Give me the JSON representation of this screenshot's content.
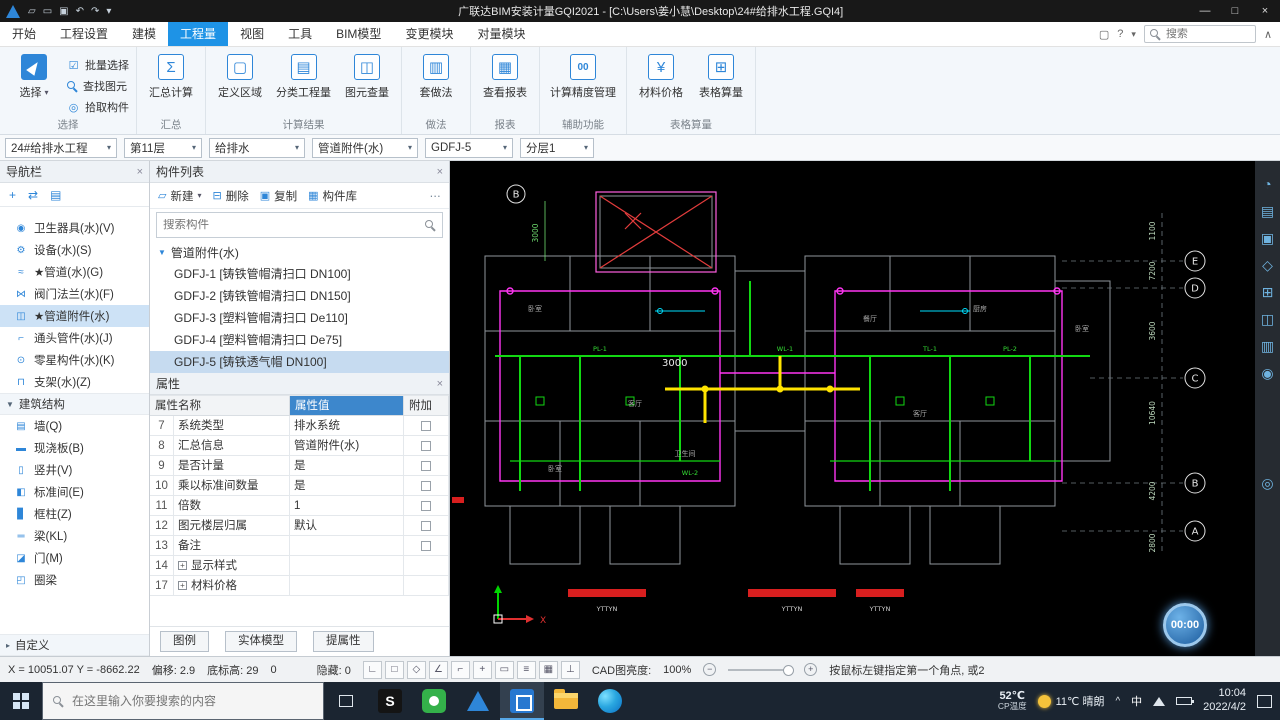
{
  "titlebar": {
    "title": "广联达BIM安装计量GQI2021 - [C:\\Users\\姜小慧\\Desktop\\24#给排水工程.GQI4]"
  },
  "glyphs": {
    "caret_down": "▾",
    "caret_right": "▸",
    "tree_open": "▼",
    "minimize": "—",
    "maximize": "□",
    "close": "×",
    "more": "⋯",
    "collapse": "∧",
    "expand": "+",
    "minus": "−",
    "plus": "+",
    "chevron_up": "^"
  },
  "icons": {
    "quick_access": [
      "▱",
      "▭",
      "▣",
      "↶",
      "↷",
      "▾"
    ],
    "tab_extras": [
      "▢",
      "?"
    ],
    "ribbon": {
      "batch": "☑",
      "pick": "◎",
      "sum": "Σ",
      "define_region": "▢",
      "classified": "▤",
      "element_query": "◫",
      "apply": "▥",
      "report": "▦",
      "precision": "00",
      "price": "¥",
      "table": "⊞"
    },
    "nav_tools": [
      "+",
      "⇄",
      "▤"
    ],
    "nav_items": [
      "◉",
      "⚙",
      "≈",
      "⋈",
      "◫",
      "⌐",
      "⊙",
      "⊓"
    ],
    "nav_structure": [
      "▤",
      "▬",
      "▯",
      "◧",
      "▊",
      "═",
      "◪",
      "◰"
    ],
    "comp_tools": [
      "▱",
      "⊟",
      "▣",
      "▦"
    ],
    "canvas_tools": [
      "◔",
      "▤",
      "▣",
      "◇",
      "⊞",
      "◫",
      "▥",
      "◉",
      "◎"
    ],
    "status_tools": [
      "∟",
      "□",
      "◇",
      "∠",
      "⌐",
      "+",
      "▭",
      "≡",
      "▦",
      "⊥"
    ]
  },
  "tabs": {
    "items": [
      "开始",
      "工程设置",
      "建模",
      "工程量",
      "视图",
      "工具",
      "BIM模型",
      "变更模块",
      "对量模块"
    ],
    "search_placeholder": "搜索"
  },
  "ribbon": {
    "buttons": {
      "select": "选择",
      "batch_select": "批量选择",
      "find_element": "查找图元",
      "pick_component": "拾取构件",
      "sum_calc": "汇总计算",
      "define_region": "定义区域",
      "classified_qty": "分类工程量",
      "element_query": "图元查量",
      "apply_method": "套做法",
      "view_report": "查看报表",
      "precision_mgmt": "计算精度管理",
      "material_price": "材料价格",
      "table_qty": "表格算量"
    },
    "groups": {
      "select": "选择",
      "summary": "汇总",
      "calc_result": "计算结果",
      "method": "做法",
      "report": "报表",
      "aux": "辅助功能",
      "table": "表格算量"
    }
  },
  "selector": {
    "project": "24#给排水工程",
    "floor": "第11层",
    "discipline": "给排水",
    "category": "管道附件(水)",
    "component": "GDFJ-5",
    "layer": "分层1"
  },
  "nav": {
    "title": "导航栏",
    "items": [
      "卫生器具(水)(V)",
      "设备(水)(S)",
      "★管道(水)(G)",
      "阀门法兰(水)(F)",
      "★管道附件(水)",
      "通头管件(水)(J)",
      "零星构件(水)(K)",
      "支架(水)(Z)"
    ],
    "structure_label": "建筑结构",
    "structure_items": [
      "墙(Q)",
      "现浇板(B)",
      "竖井(V)",
      "标准间(E)",
      "框柱(Z)",
      "梁(KL)",
      "门(M)",
      "圈梁"
    ],
    "custom_label": "自定义"
  },
  "components": {
    "title": "构件列表",
    "toolbar": {
      "new": "新建",
      "delete": "删除",
      "copy": "复制",
      "library": "构件库"
    },
    "search_placeholder": "搜索构件",
    "group": "管道附件(水)",
    "items": [
      "GDFJ-1 [铸铁管帽清扫口 DN100]",
      "GDFJ-2 [铸铁管帽清扫口 DN150]",
      "GDFJ-3 [塑料管帽清扫口 De110]",
      "GDFJ-4 [塑料管帽清扫口 De75]",
      "GDFJ-5 [铸铁透气帽 DN100]"
    ]
  },
  "properties": {
    "title": "属性",
    "headers": [
      "属性名称",
      "属性值",
      "附加"
    ],
    "rows": [
      {
        "n": "7",
        "name": "系统类型",
        "value": "排水系统"
      },
      {
        "n": "8",
        "name": "汇总信息",
        "value": "管道附件(水)"
      },
      {
        "n": "9",
        "name": "是否计量",
        "value": "是"
      },
      {
        "n": "10",
        "name": "乘以标准间数量",
        "value": "是"
      },
      {
        "n": "11",
        "name": "倍数",
        "value": "1"
      },
      {
        "n": "12",
        "name": "图元楼层归属",
        "value": "默认"
      },
      {
        "n": "13",
        "name": "备注",
        "value": ""
      },
      {
        "n": "14",
        "name": "显示样式",
        "value": ""
      },
      {
        "n": "17",
        "name": "材料价格",
        "value": ""
      }
    ],
    "footer": [
      "图例",
      "实体模型",
      "提属性"
    ]
  },
  "canvas": {
    "axis_top": "B",
    "axis": [
      "E",
      "D",
      "C",
      "B",
      "A"
    ],
    "dims": [
      "1100",
      "7200",
      "3600",
      "10640",
      "4200",
      "2800"
    ],
    "dim_left": "3000",
    "dim_center": "3000",
    "yttyn": [
      "YTTYN",
      "YTTYN",
      "YTTYN"
    ],
    "pipe_labels": [
      "PL-1",
      "WL-1",
      "TL-1",
      "PL-2",
      "WL-2"
    ],
    "room_labels": [
      "卧室",
      "客厅",
      "餐厅",
      "厨房",
      "卫生间",
      "卧室",
      "卧室",
      "客厅"
    ],
    "ucs_x": "X",
    "timer": "00:00"
  },
  "statusbar": {
    "coords": "X = 10051.07 Y = -8662.22",
    "offset": "偏移: 2.9",
    "elevation": "底标高: 29",
    "extra": "0",
    "hidden": "隐藏: 0",
    "brightness_label": "CAD图亮度:",
    "brightness_value": "100%",
    "hint": "按鼠标左键指定第一个角点, 或2"
  },
  "taskbar": {
    "search_placeholder": "在这里输入你要搜索的内容",
    "app_s": "S",
    "cpu_temp": "52℃",
    "cpu_label": "CP温度",
    "weather": "11℃ 晴朗",
    "ime": "中",
    "time": "10:04",
    "date": "2022/4/2"
  }
}
